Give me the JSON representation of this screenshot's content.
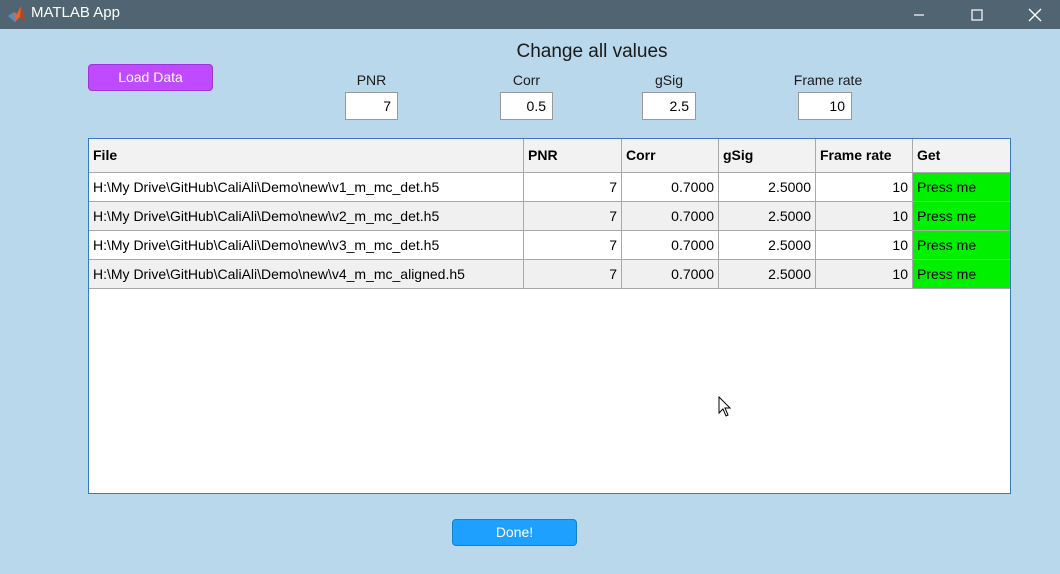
{
  "window": {
    "title": "MATLAB App",
    "icon": "matlab-logo-icon"
  },
  "toolbar": {
    "load_label": "Load Data",
    "heading": "Change all values",
    "params": [
      {
        "label": "PNR",
        "value": "7"
      },
      {
        "label": "Corr",
        "value": "0.5"
      },
      {
        "label": "gSig",
        "value": "2.5"
      },
      {
        "label": "Frame rate",
        "value": "10"
      }
    ]
  },
  "table": {
    "columns": [
      "File",
      "PNR",
      "Corr",
      "gSig",
      "Frame rate",
      "Get"
    ],
    "rows": [
      {
        "file": "H:\\My Drive\\GitHub\\CaliAli\\Demo\\new\\v1_m_mc_det.h5",
        "pnr": "7",
        "corr": "0.7000",
        "gsig": "2.5000",
        "fr": "10",
        "get": "Press me"
      },
      {
        "file": "H:\\My Drive\\GitHub\\CaliAli\\Demo\\new\\v2_m_mc_det.h5",
        "pnr": "7",
        "corr": "0.7000",
        "gsig": "2.5000",
        "fr": "10",
        "get": "Press me"
      },
      {
        "file": "H:\\My Drive\\GitHub\\CaliAli\\Demo\\new\\v3_m_mc_det.h5",
        "pnr": "7",
        "corr": "0.7000",
        "gsig": "2.5000",
        "fr": "10",
        "get": "Press me"
      },
      {
        "file": "H:\\My Drive\\GitHub\\CaliAli\\Demo\\new\\v4_m_mc_aligned.h5",
        "pnr": "7",
        "corr": "0.7000",
        "gsig": "2.5000",
        "fr": "10",
        "get": "Press me"
      }
    ]
  },
  "footer": {
    "done_label": "Done!"
  },
  "colors": {
    "background": "#b9d8eb",
    "titlebar": "#506471",
    "load_button": "#c04aff",
    "done_button": "#1ea0ff",
    "get_cell": "#00f000",
    "table_border": "#3a78c4"
  }
}
